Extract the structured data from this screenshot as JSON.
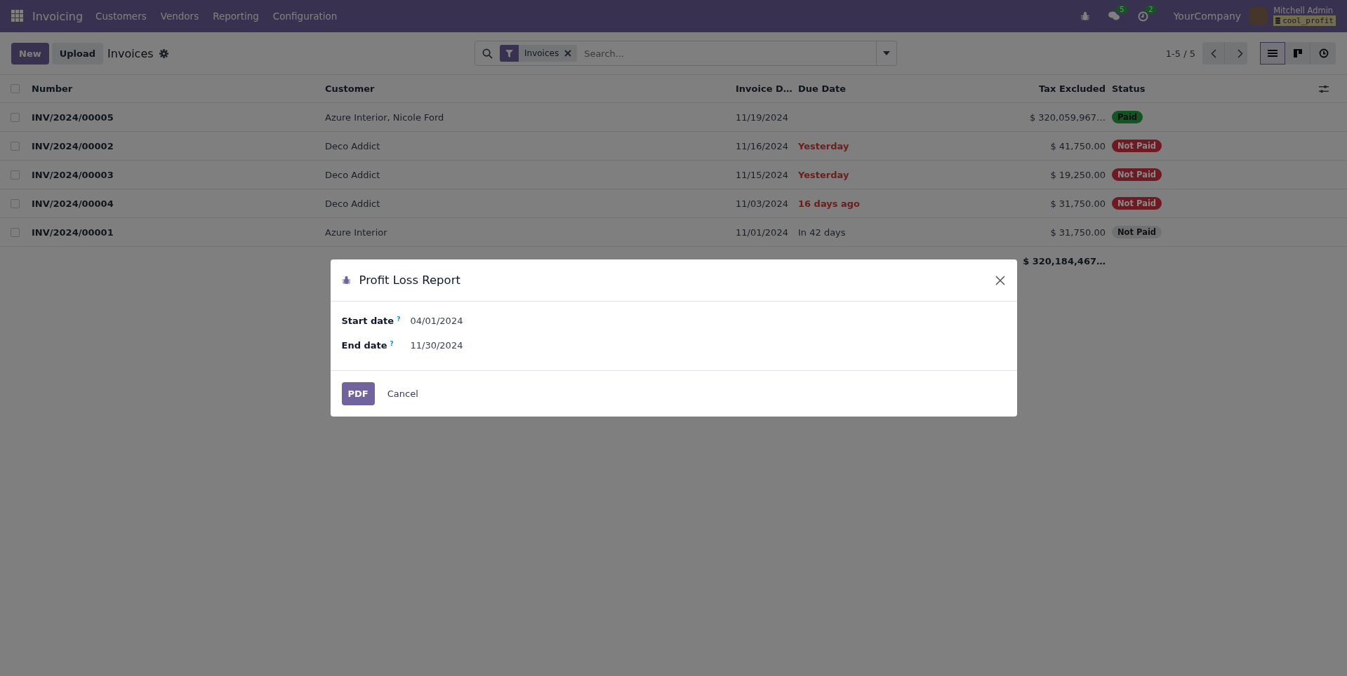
{
  "navbar": {
    "app_name": "Invoicing",
    "menu": [
      "Customers",
      "Vendors",
      "Reporting",
      "Configuration"
    ],
    "messages_count": "5",
    "activities_count": "2",
    "company": "YourCompany",
    "user_name": "Mitchell Admin",
    "database": "cool_profit"
  },
  "control_panel": {
    "buttons": [
      "New",
      "Upload"
    ],
    "title": "Invoices",
    "search": {
      "facet": "Invoices",
      "placeholder": "Search..."
    },
    "pager": "1-5 / 5",
    "views": [
      {
        "kind": "list",
        "selected": true
      },
      {
        "kind": "kanban",
        "selected": false
      },
      {
        "kind": "activity",
        "selected": false
      }
    ]
  },
  "table": {
    "select_all_checked": false,
    "columns": [
      "Number",
      "Customer",
      "Invoice D…",
      "Due Date",
      "Tax Excluded",
      "Status"
    ],
    "rows": [
      {
        "number": "INV/2024/00005",
        "customer": "Azure Interior, Nicole Ford",
        "invoice_date": "11/19/2024",
        "tax_excluded": "$ 320,059,967…",
        "status": {
          "label": "Paid",
          "color": "#145323"
        },
        "checked": false
      },
      {
        "number": "INV/2024/00002",
        "customer": "Deco Addict",
        "invoice_date": "11/16/2024",
        "due_date": "Yesterday",
        "overdue": true,
        "tax_excluded": "$ 41,750.00",
        "status": {
          "label": "Not Paid",
          "color": "#6e1a22"
        },
        "checked": false
      },
      {
        "number": "INV/2024/00003",
        "customer": "Deco Addict",
        "invoice_date": "11/15/2024",
        "due_date": "Yesterday",
        "overdue": true,
        "tax_excluded": "$ 19,250.00",
        "status": {
          "label": "Not Paid",
          "color": "#6e1a22"
        },
        "checked": false
      },
      {
        "number": "INV/2024/00004",
        "customer": "Deco Addict",
        "invoice_date": "11/03/2024",
        "due_date": "16 days ago",
        "overdue": true,
        "tax_excluded": "$ 31,750.00",
        "status": {
          "label": "Not Paid",
          "color": "#6e1a22"
        },
        "checked": false
      },
      {
        "number": "INV/2024/00001",
        "customer": "Azure Interior",
        "invoice_date": "11/01/2024",
        "due_date": "In 42 days",
        "overdue": false,
        "tax_excluded": "$ 31,750.00",
        "status": {
          "label": "Not Paid",
          "color": "#707173"
        },
        "checked": false
      }
    ],
    "total": "$ 320,184,467…"
  },
  "dialog": {
    "title": "Profit Loss Report",
    "fields": [
      {
        "label": "Start date",
        "help": "?",
        "value": "04/01/2024"
      },
      {
        "label": "End date",
        "help": "?",
        "value": "11/30/2024"
      }
    ],
    "primary_button": "PDF",
    "cancel_button": "Cancel"
  }
}
